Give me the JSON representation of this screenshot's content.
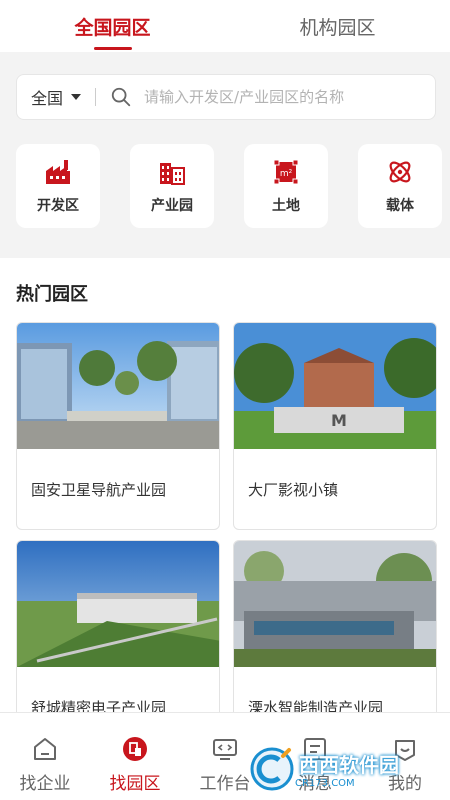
{
  "tabs": [
    {
      "label": "全国园区",
      "active": true
    },
    {
      "label": "机构园区",
      "active": false
    }
  ],
  "search": {
    "region": "全国",
    "placeholder": "请输入开发区/产业园区的名称",
    "value": ""
  },
  "categories": [
    {
      "label": "开发区",
      "icon": "factory-icon"
    },
    {
      "label": "产业园",
      "icon": "buildings-icon"
    },
    {
      "label": "土地",
      "icon": "land-icon"
    },
    {
      "label": "载体",
      "icon": "atom-icon"
    }
  ],
  "hot": {
    "title": "热门园区",
    "parks": [
      {
        "name": "固安卫星导航产业园"
      },
      {
        "name": "大厂影视小镇"
      },
      {
        "name": "舒城精密电子产业园"
      },
      {
        "name": "溧水智能制造产业园"
      }
    ]
  },
  "nav": [
    {
      "label": "找企业",
      "icon": "home-icon",
      "active": false
    },
    {
      "label": "找园区",
      "icon": "park-icon",
      "active": true
    },
    {
      "label": "工作台",
      "icon": "workbench-icon",
      "active": false
    },
    {
      "label": "消息",
      "icon": "message-icon",
      "active": false
    },
    {
      "label": "我的",
      "icon": "profile-icon",
      "active": false
    }
  ],
  "watermark": {
    "text": "西西软件园",
    "sub": "CR173.COM"
  },
  "colors": {
    "accent": "#c8161d",
    "background": "#f3f3f3"
  }
}
